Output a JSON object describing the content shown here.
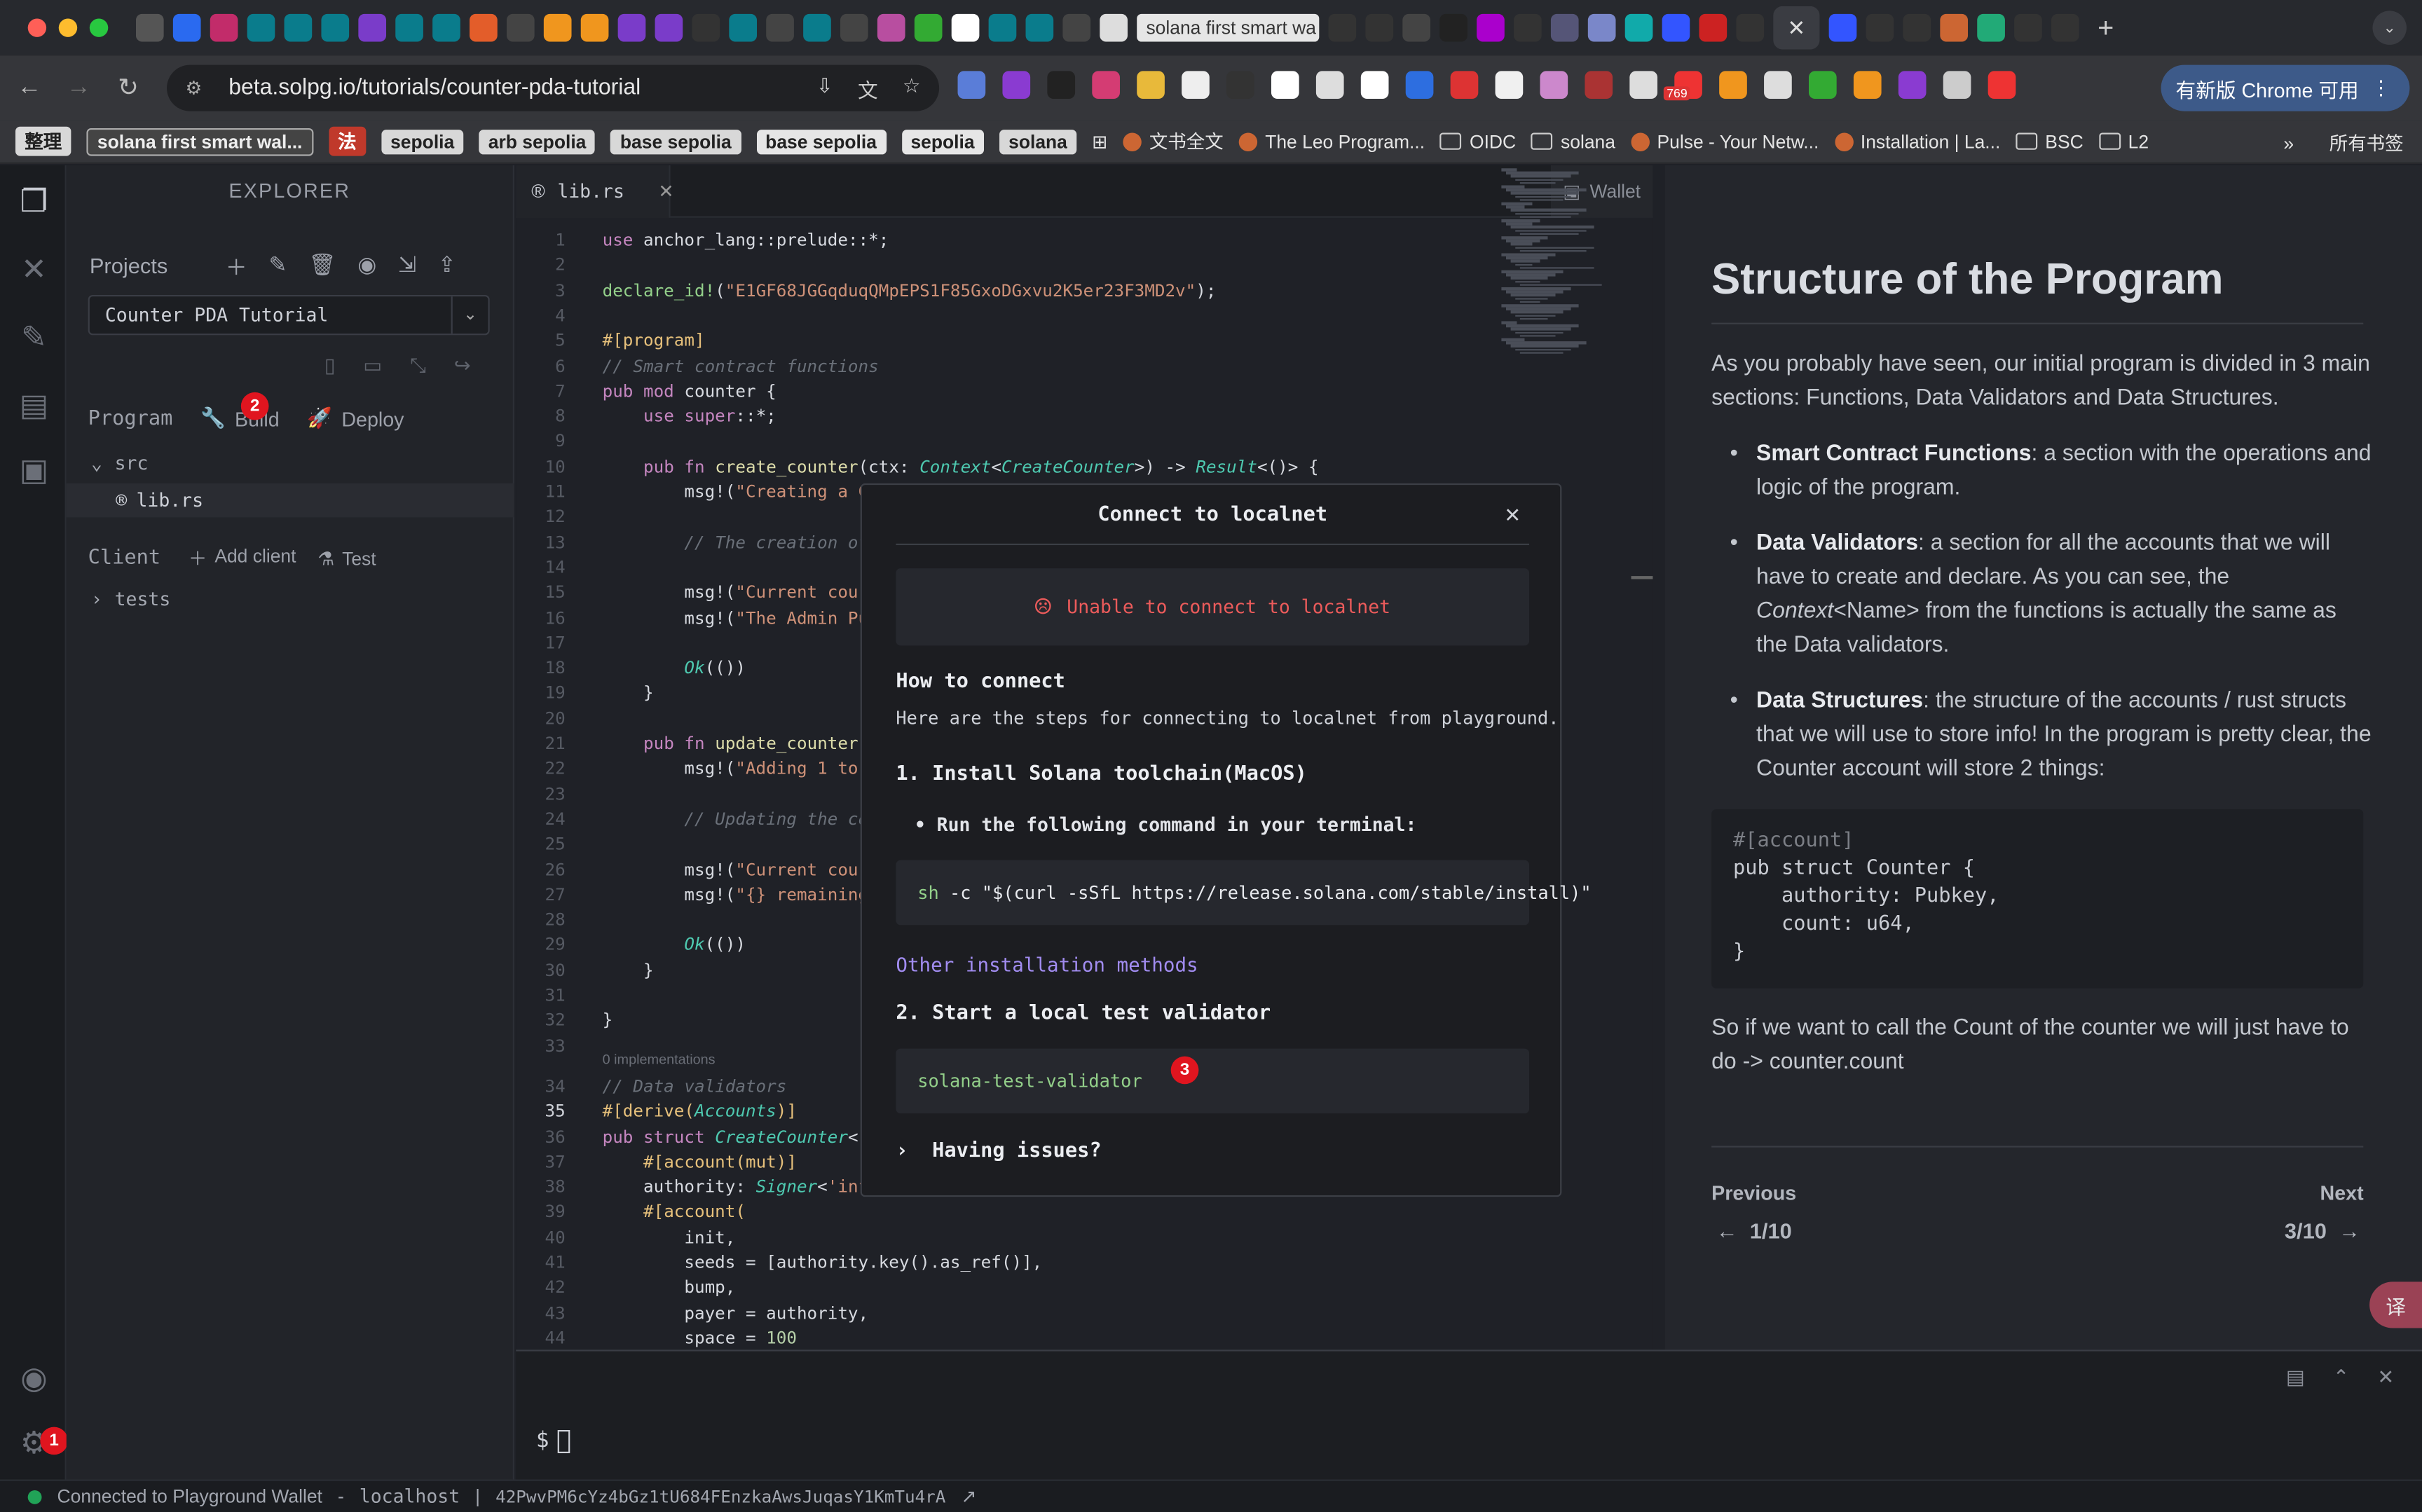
{
  "browser": {
    "tab_title": "solana first smart wa",
    "tab_close": "✕",
    "update_button": "有新版 Chrome 可用",
    "url": "beta.solpg.io/tutorials/counter-pda-tutorial",
    "bookmarks": [
      {
        "label": "整理",
        "style": "pill"
      },
      {
        "label": "solana first smart wal...",
        "style": "outline"
      },
      {
        "label": "法",
        "style": "pill-red"
      },
      {
        "label": "sepolia",
        "style": "pill"
      },
      {
        "label": "arb sepolia",
        "style": "pill"
      },
      {
        "label": "base sepolia",
        "style": "pill"
      },
      {
        "label": "base sepolia",
        "style": "pill-light"
      },
      {
        "label": "sepolia",
        "style": "pill-light"
      },
      {
        "label": "solana",
        "style": "pill"
      },
      {
        "label": "文书全文",
        "style": "link"
      },
      {
        "label": "The Leo Program...",
        "style": "link"
      },
      {
        "label": "OIDC",
        "style": "folder"
      },
      {
        "label": "solana",
        "style": "folder"
      },
      {
        "label": "Pulse - Your Netw...",
        "style": "link"
      },
      {
        "label": "Installation | La...",
        "style": "link"
      },
      {
        "label": "BSC",
        "style": "folder"
      },
      {
        "label": "L2",
        "style": "folder"
      }
    ],
    "all_bookmarks": "所有书签",
    "more": "»",
    "ext_badge": "769"
  },
  "sidebar": {
    "title": "EXPLORER",
    "projects_label": "Projects",
    "project_selected": "Counter PDA Tutorial",
    "program_label": "Program",
    "build_label": "Build",
    "deploy_label": "Deploy",
    "folder_src": "src",
    "file_lib": "lib.rs",
    "client_label": "Client",
    "add_client_label": "Add client",
    "test_label": "Test",
    "folder_tests": "tests",
    "badge_build": "2",
    "badge_settings": "1"
  },
  "editor": {
    "tab": "lib.rs",
    "wallet_tab": "Wallet",
    "implementations_hint": "0 implementations",
    "line_numbers": [
      "1",
      "2",
      "3",
      "4",
      "5",
      "6",
      "7",
      "8",
      "9",
      "10",
      "11",
      "12",
      "13",
      "14",
      "15",
      "16",
      "17",
      "18",
      "19",
      "20",
      "21",
      "22",
      "23",
      "24",
      "25",
      "26",
      "27",
      "28",
      "29",
      "30",
      "31",
      "32",
      "33",
      "34",
      "35",
      "36",
      "37",
      "38",
      "39",
      "40",
      "41",
      "42",
      "43",
      "44"
    ]
  },
  "modal": {
    "title": "Connect to localnet",
    "close": "✕",
    "error": "Unable to connect to localnet",
    "how_heading": "How to connect",
    "how_text": "Here are the steps for connecting to localnet from playground.",
    "step1": "1. Install Solana toolchain(MacOS)",
    "step1_bullet": "Run the following command in your terminal:",
    "install_cmd": "sh -c \"$(curl -sSfL https://release.solana.com/stable/install)\"",
    "other_methods": "Other installation methods",
    "step2": "2. Start a local test validator",
    "validator_cmd": "solana-test-validator",
    "having_issues": "Having issues?",
    "badge": "3"
  },
  "doc": {
    "title": "Structure of the Program",
    "intro": "As you probably have seen, our initial program is divided in 3 main sections: Functions, Data Validators and Data Structures.",
    "bullets": [
      {
        "bold": "Smart Contract Functions",
        "text": ": a section with the operations and logic of the program."
      },
      {
        "bold": "Data Validators",
        "text": ": a section for all the accounts that we will have to create and declare. As you can see, the ",
        "italic": "Context",
        "text2": "<Name> from the functions is actually the same as the Data validators."
      },
      {
        "bold": "Data Structures",
        "text": ": the structure of the accounts / rust structs that we will use to store info! In the program is pretty clear, the Counter account will store 2 things:"
      }
    ],
    "code_lines": [
      "#[account]",
      "pub struct Counter {",
      "    authority: Pubkey,",
      "    count: u64,",
      "}"
    ],
    "outro": "So if we want to call the Count of the counter we will just have to do -> counter.count",
    "previous_label": "Previous",
    "previous_page": "1/10",
    "next_label": "Next",
    "next_page": "3/10",
    "translate": "译"
  },
  "terminal": {
    "prompt": "$"
  },
  "status": {
    "wallet": "Connected to Playground Wallet",
    "sep1": "-",
    "network": "localhost",
    "sep2": "|",
    "address": "42PwvPM6cYz4bGz1tU684FEnzkaAwsJuqasY1KmTu4rA"
  }
}
